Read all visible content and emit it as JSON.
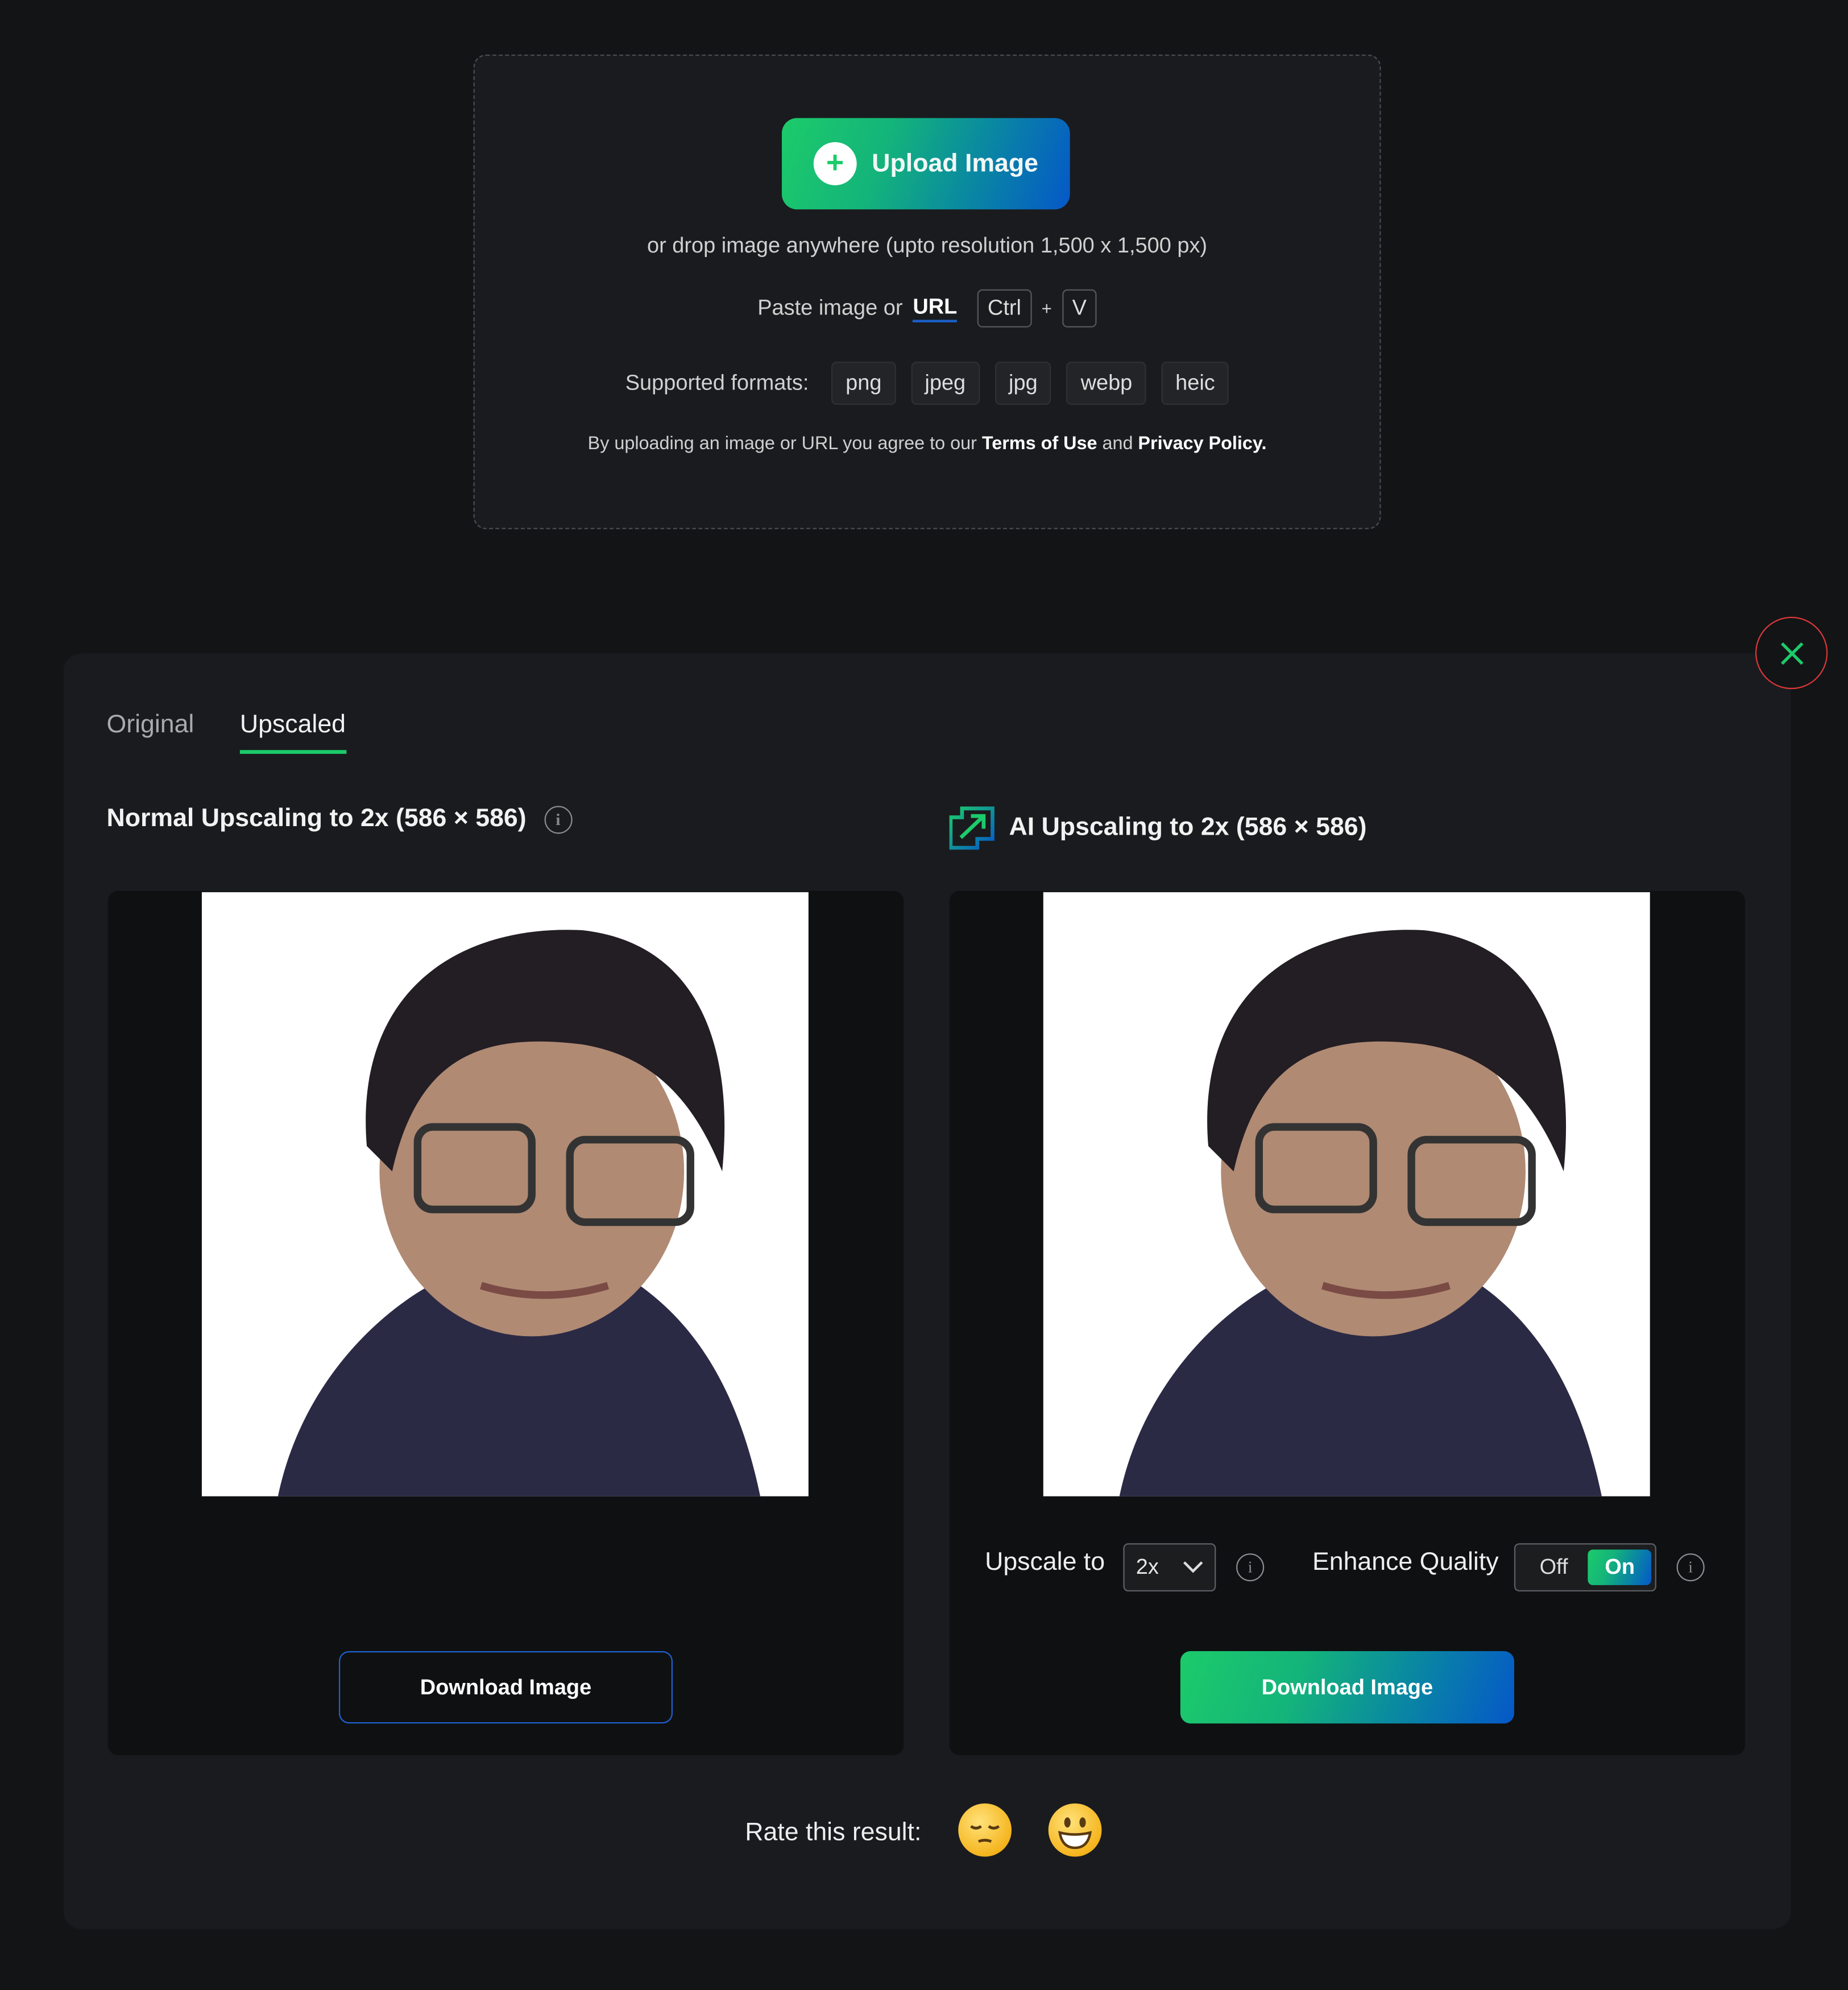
{
  "upload": {
    "button_label": "Upload Image",
    "drop_hint": "or drop image anywhere (upto resolution 1,500 x 1,500 px)",
    "paste_prefix": "Paste image or",
    "paste_link": "URL",
    "key_ctrl": "Ctrl",
    "key_plus": "+",
    "key_v": "V",
    "formats_label": "Supported formats:",
    "formats": [
      "png",
      "jpeg",
      "jpg",
      "webp",
      "heic"
    ],
    "terms_prefix": "By uploading an image or URL you agree to our",
    "terms_link": "Terms of Use",
    "terms_and": "and",
    "privacy_link": "Privacy Policy."
  },
  "result": {
    "tabs": [
      {
        "label": "Original"
      },
      {
        "label": "Upscaled",
        "active": true
      }
    ],
    "left": {
      "title": "Normal Upscaling to 2x (586 × 586)",
      "download_label": "Download Image"
    },
    "right": {
      "title": "AI Upscaling to 2x (586 × 586)",
      "download_label": "Download Image"
    },
    "controls": {
      "upscale_label": "Upscale to",
      "upscale_value": "2x",
      "enhance_label": "Enhance Quality",
      "toggle_off": "Off",
      "toggle_on": "On",
      "enhance_state": "On"
    },
    "rating_label": "Rate this result:"
  },
  "colors": {
    "background": "#131416",
    "panel": "#1a1b1e",
    "accent_green": "#1ccb6a",
    "accent_blue": "#0558c8",
    "close_red": "#d8373a"
  },
  "icons": [
    "plus-icon",
    "close-icon",
    "info-icon",
    "ai-upscale-icon",
    "chevron-down-icon",
    "sleepy-emoji-icon",
    "grinning-emoji-icon"
  ]
}
